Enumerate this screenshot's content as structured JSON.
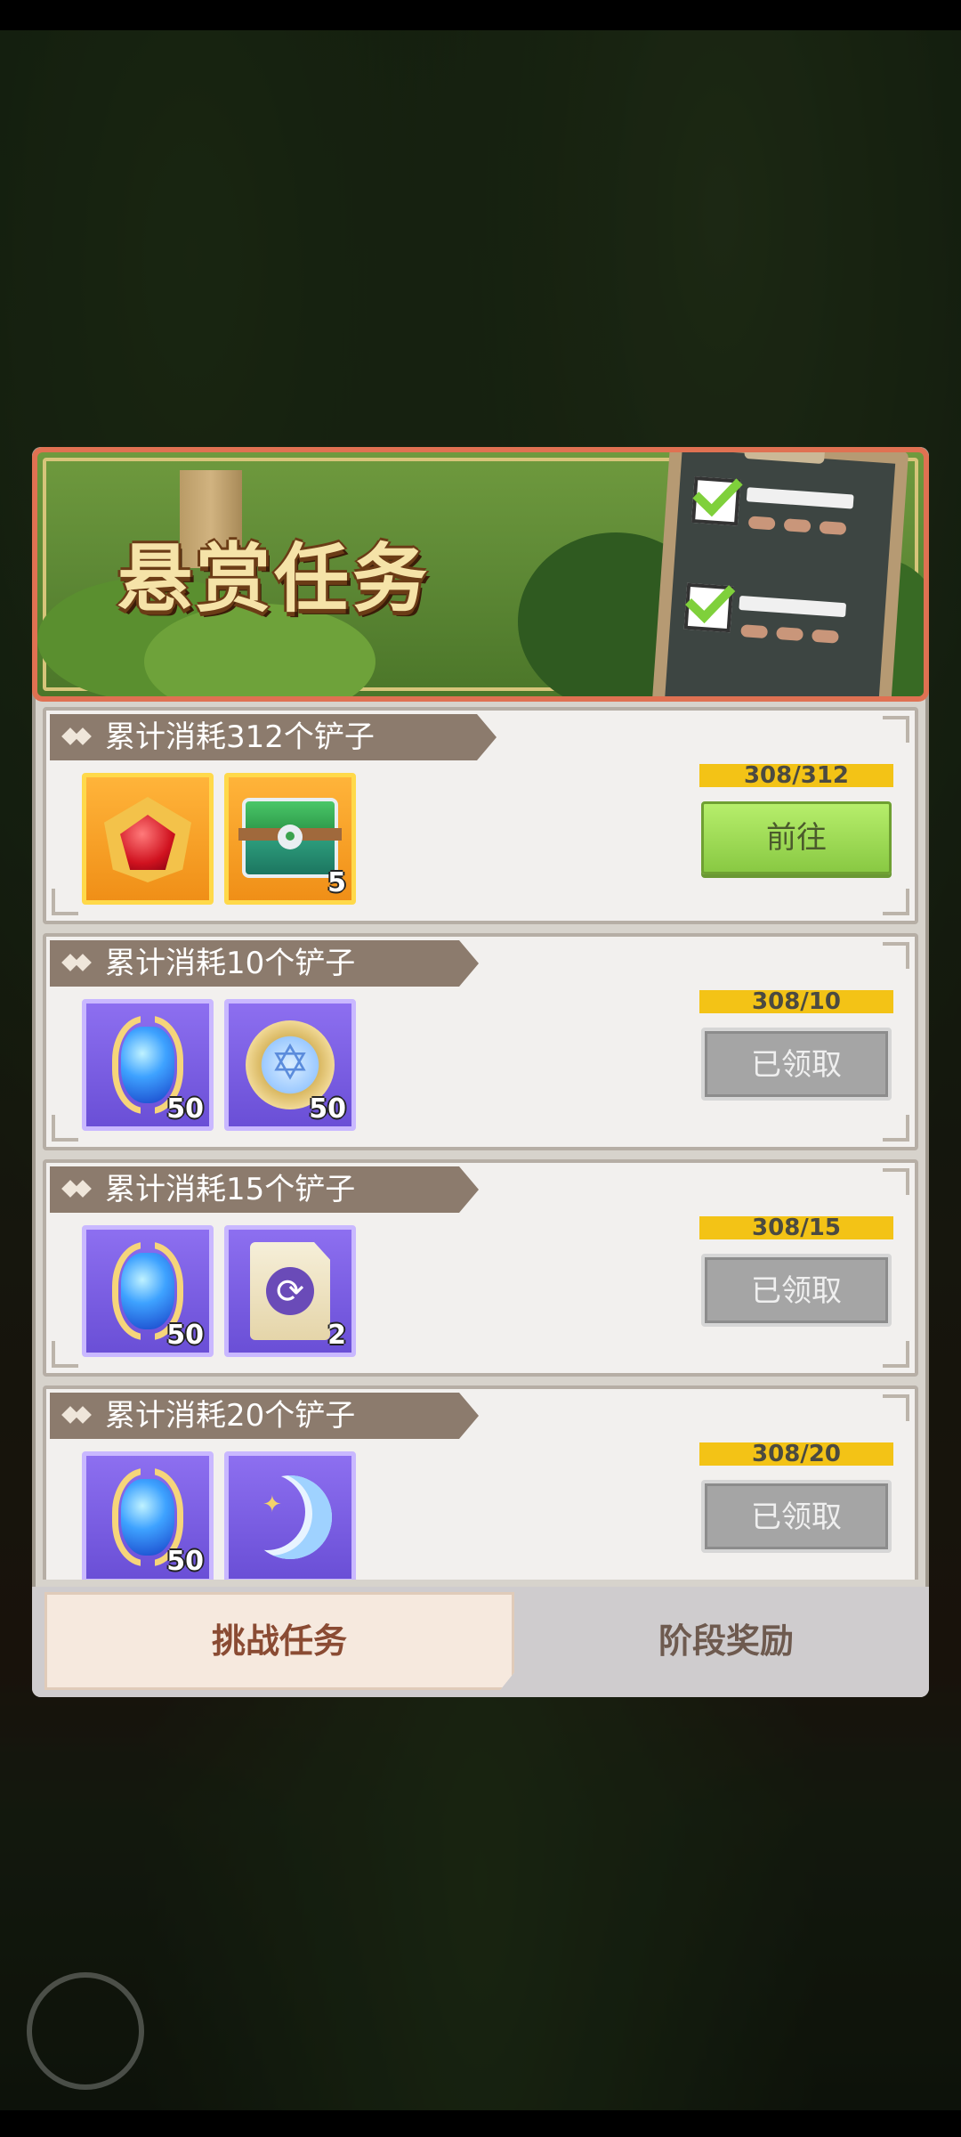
{
  "banner": {
    "title": "悬赏任务"
  },
  "tasks": [
    {
      "title": "累计消耗312个铲子",
      "progress": "308/312",
      "button": "前往",
      "status": "go",
      "rewards": [
        {
          "icon": "ruby-emblem-icon",
          "count": ""
        },
        {
          "icon": "green-chest-icon",
          "count": "5"
        }
      ]
    },
    {
      "title": "累计消耗10个铲子",
      "progress": "308/10",
      "button": "已领取",
      "status": "done",
      "rewards": [
        {
          "icon": "blue-crystal-icon",
          "count": "50"
        },
        {
          "icon": "star-medal-icon",
          "count": "50"
        }
      ]
    },
    {
      "title": "累计消耗15个铲子",
      "progress": "308/15",
      "button": "已领取",
      "status": "done",
      "rewards": [
        {
          "icon": "blue-crystal-icon",
          "count": "50"
        },
        {
          "icon": "refresh-card-icon",
          "count": "2"
        }
      ]
    },
    {
      "title": "累计消耗20个铲子",
      "progress": "308/20",
      "button": "已领取",
      "status": "done",
      "rewards": [
        {
          "icon": "blue-crystal-icon",
          "count": "50"
        },
        {
          "icon": "crescent-moon-icon",
          "count": ""
        }
      ]
    }
  ],
  "tabs": {
    "challenge": "挑战任务",
    "stage_reward": "阶段奖励",
    "active": "challenge"
  },
  "colors": {
    "accent_gold": "#f3c316",
    "button_green": "#9cdc55",
    "claimed_gray": "#a5a5a5",
    "banner_border": "#e07152"
  }
}
